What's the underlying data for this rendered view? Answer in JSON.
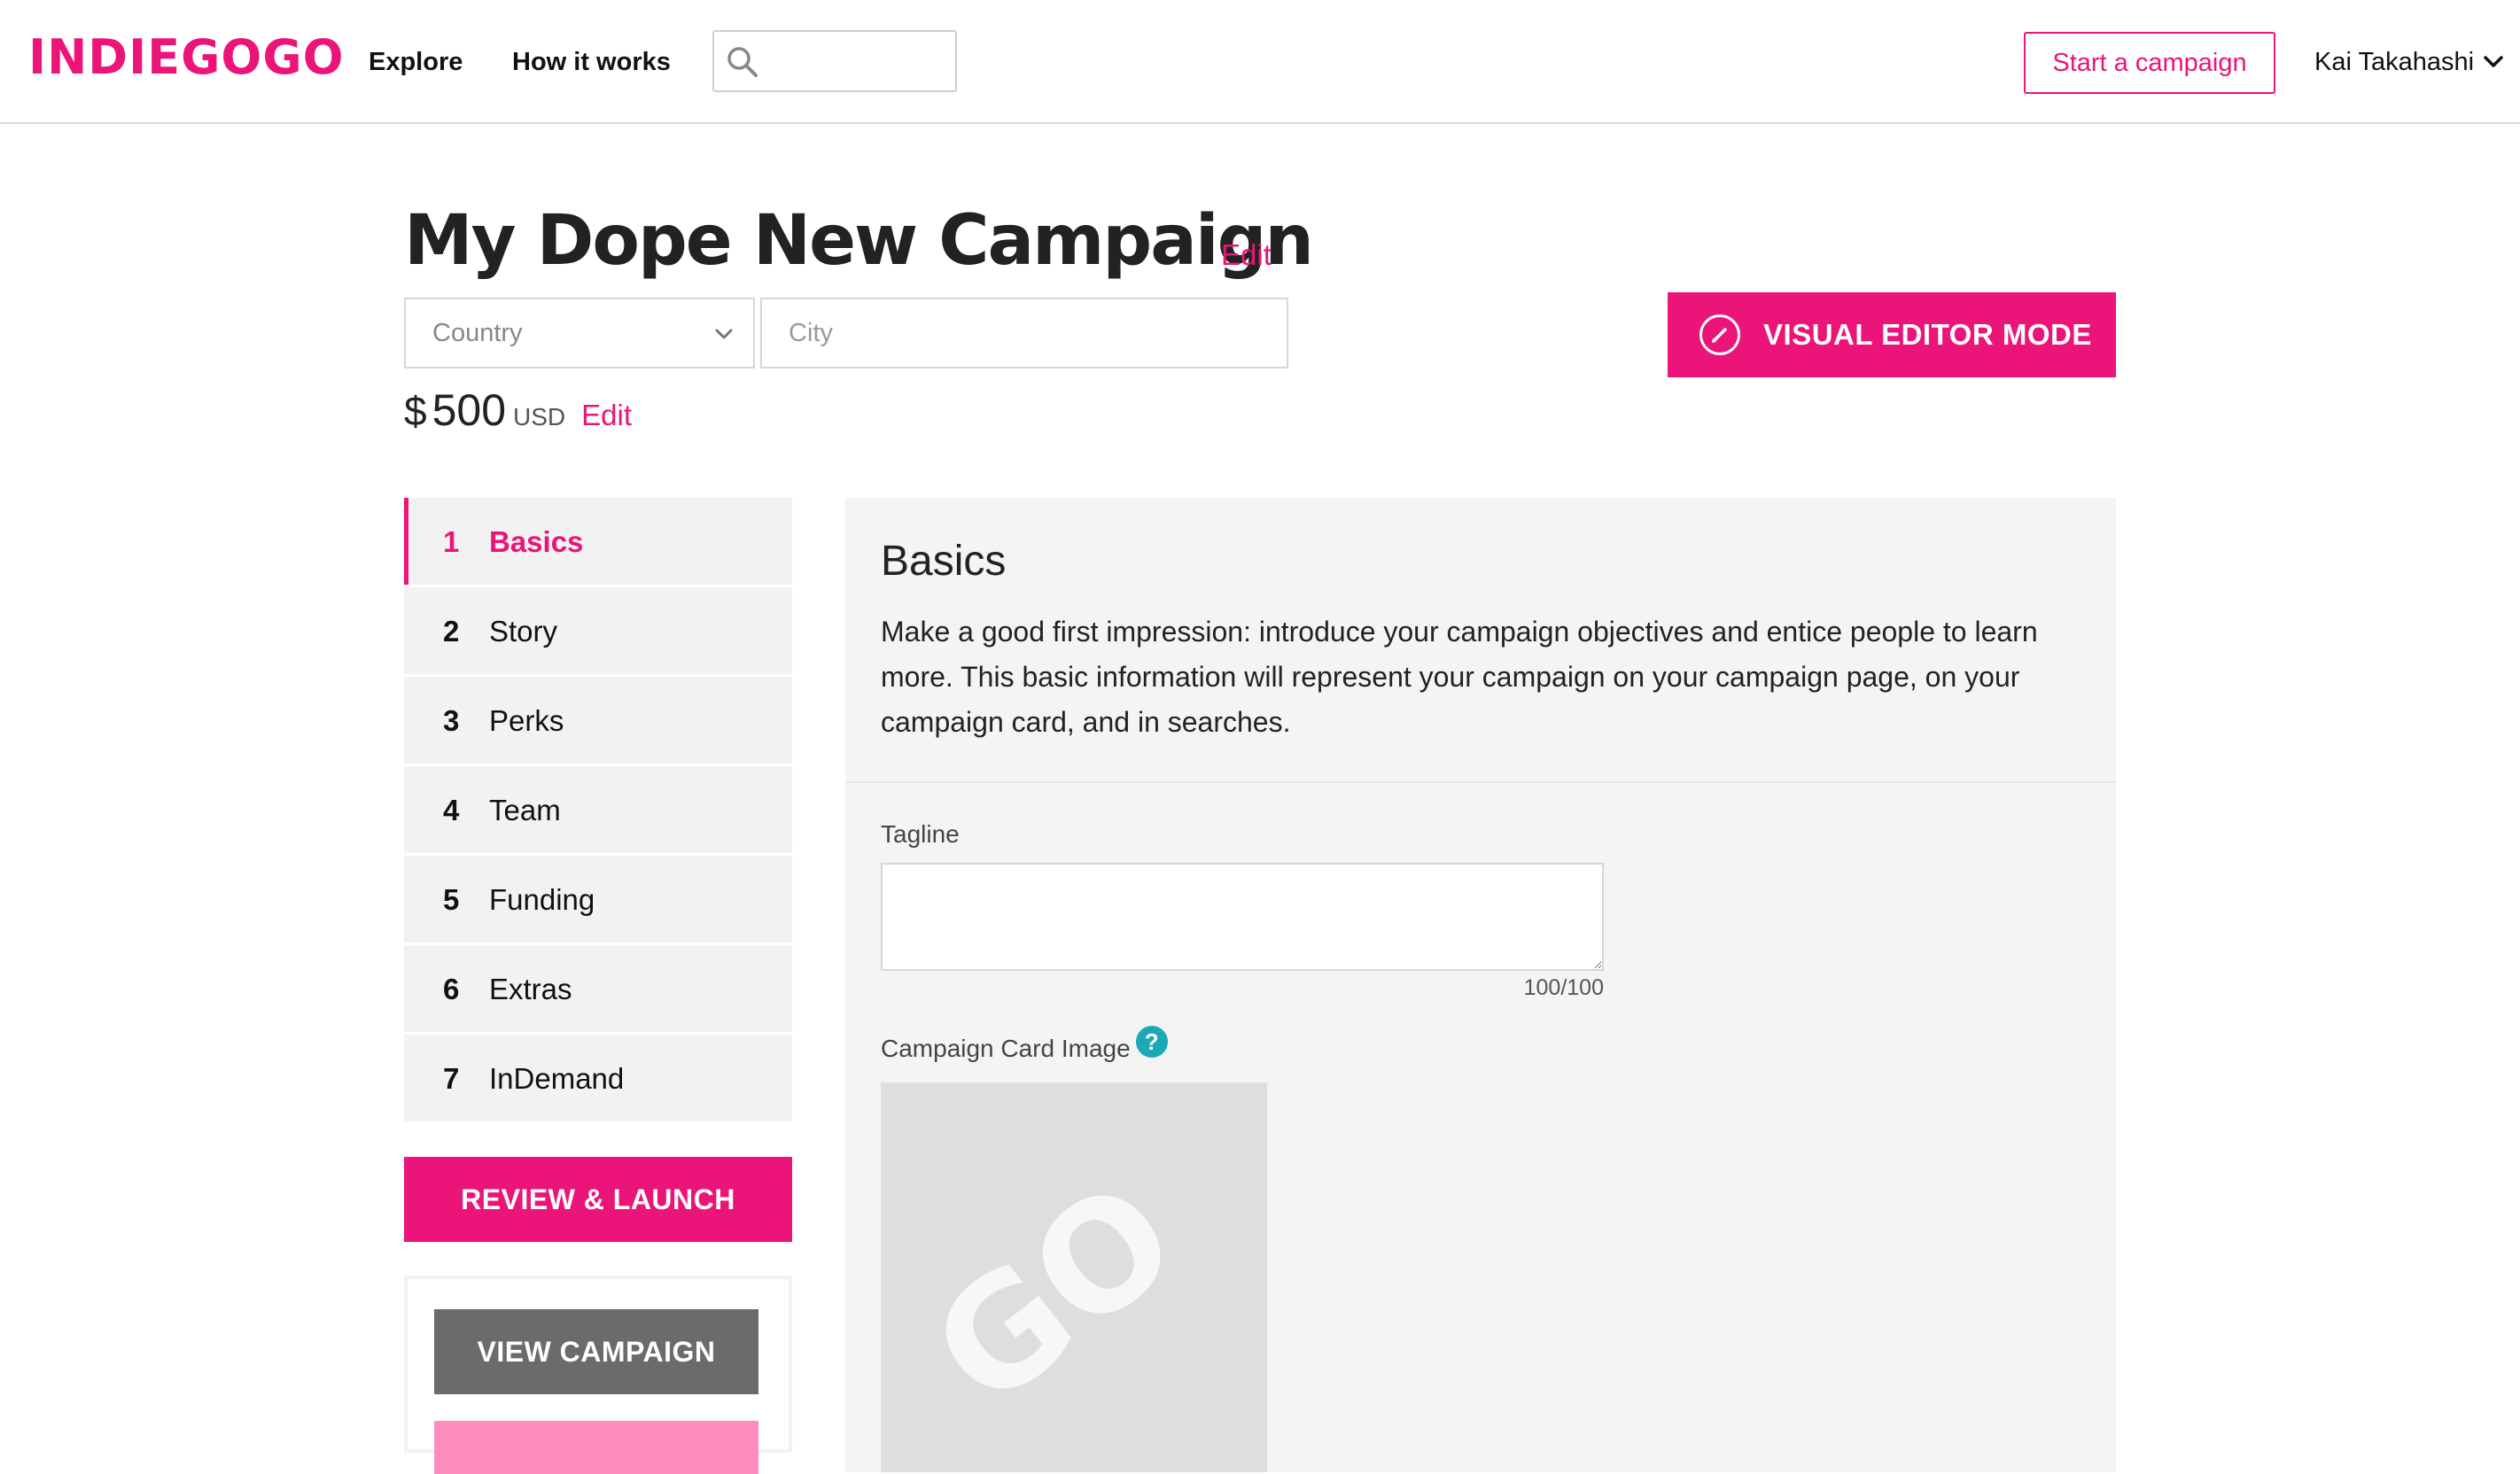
{
  "header": {
    "logo": "INDIEGOGO",
    "nav": {
      "explore": "Explore",
      "how_it_works": "How it works"
    },
    "search": {
      "placeholder": ""
    },
    "start_campaign": "Start a campaign",
    "user_name": "Kai Takahashi"
  },
  "campaign": {
    "title": "My Dope New Campaign",
    "title_edit": "Edit",
    "country_placeholder": "Country",
    "city_placeholder": "City",
    "goal_currency": "$",
    "goal_amount": "500",
    "goal_unit": "USD",
    "goal_edit": "Edit",
    "visual_editor": "VISUAL EDITOR MODE"
  },
  "sidebar": {
    "steps": [
      {
        "num": "1",
        "label": "Basics",
        "active": true
      },
      {
        "num": "2",
        "label": "Story"
      },
      {
        "num": "3",
        "label": "Perks"
      },
      {
        "num": "4",
        "label": "Team"
      },
      {
        "num": "5",
        "label": "Funding"
      },
      {
        "num": "6",
        "label": "Extras"
      },
      {
        "num": "7",
        "label": "InDemand"
      }
    ],
    "review_launch": "REVIEW & LAUNCH",
    "view_campaign": "VIEW CAMPAIGN"
  },
  "basics": {
    "title": "Basics",
    "description": "Make a good first impression: introduce your campaign objectives and entice people to learn more. This basic information will represent your campaign on your campaign page, on your campaign card, and in searches.",
    "tagline_label": "Tagline",
    "tagline_value": "",
    "tagline_count": "100/100",
    "card_image_label": "Campaign Card Image",
    "help_glyph": "?",
    "placeholder_logo": "GO"
  },
  "colors": {
    "brand": "#eb1478",
    "brand_light": "#ff8cbf",
    "help": "#1ba9b5",
    "panel_bg": "#f4f4f4",
    "step_bg": "#f2f2f2",
    "view_btn": "#6b6b6b"
  },
  "icons": {
    "search": "search-icon",
    "user_menu": "chevron-down-icon",
    "country": "chevron-down-icon",
    "visual_editor": "pencil-icon",
    "help": "help-icon"
  }
}
